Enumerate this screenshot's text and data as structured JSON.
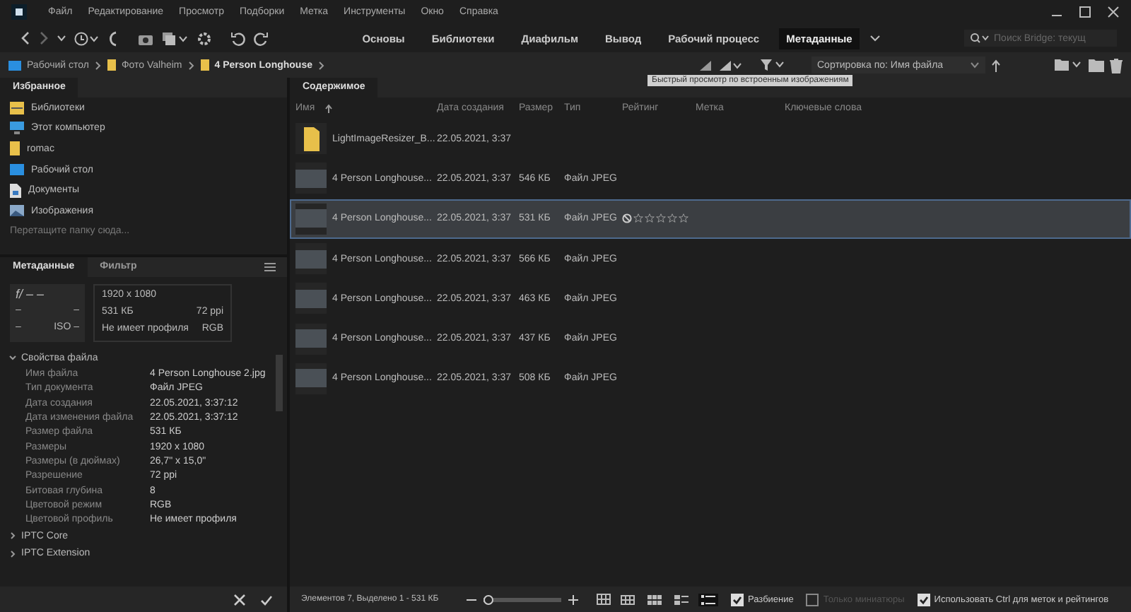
{
  "menu": [
    "Файл",
    "Редактирование",
    "Просмотр",
    "Подборки",
    "Метка",
    "Инструменты",
    "Окно",
    "Справка"
  ],
  "workspaces": [
    {
      "label": "Основы",
      "selected": false
    },
    {
      "label": "Библиотеки",
      "selected": false
    },
    {
      "label": "Диафильм",
      "selected": false
    },
    {
      "label": "Вывод",
      "selected": false
    },
    {
      "label": "Рабочий процесс",
      "selected": false
    },
    {
      "label": "Метаданные",
      "selected": true
    }
  ],
  "search": {
    "placeholder": "Поиск Bridge: текущ"
  },
  "path": [
    {
      "label": "Рабочий стол",
      "kind": "desktop"
    },
    {
      "label": "Фото Valheim",
      "kind": "folder"
    },
    {
      "label": "4 Person Longhouse",
      "kind": "folder"
    }
  ],
  "sort": {
    "value": "Сортировка по: Имя файла"
  },
  "tooltip": "Быстрый просмотр по встроенным изображениям",
  "favorites": {
    "tab": "Избранное",
    "items": [
      {
        "label": "Библиотеки",
        "kind": "library"
      },
      {
        "label": "Этот компьютер",
        "kind": "computer"
      },
      {
        "label": "romac",
        "kind": "user"
      },
      {
        "label": "Рабочий стол",
        "kind": "desktop"
      },
      {
        "label": "Документы",
        "kind": "document"
      },
      {
        "label": "Изображения",
        "kind": "image"
      }
    ],
    "hint": "Перетащите папку сюда..."
  },
  "meta_tabs": [
    {
      "label": "Метаданные",
      "selected": true
    },
    {
      "label": "Фильтр",
      "selected": false
    }
  ],
  "camera": [
    [
      "f/ –  –"
    ],
    [
      "–",
      "–"
    ],
    [
      "–",
      "ISO –"
    ]
  ],
  "image_info": [
    [
      "1920 x 1080"
    ],
    [
      "531 КБ",
      "72 ppi"
    ],
    [
      "Не имеет профиля",
      "RGB"
    ]
  ],
  "file_props": {
    "title": "Свойства файла",
    "expanded": true,
    "rows": [
      [
        "Имя файла",
        "4 Person Longhouse 2.jpg"
      ],
      [
        "Тип документа",
        "Файл JPEG"
      ],
      [
        "Дата создания",
        "22.05.2021, 3:37:12"
      ],
      [
        "Дата изменения файла",
        "22.05.2021, 3:37:12"
      ],
      [
        "Размер файла",
        "531 КБ"
      ],
      [
        "Размеры",
        "1920 x 1080"
      ],
      [
        "Размеры (в дюймах)",
        "26,7\" x 15,0\""
      ],
      [
        "Разрешение",
        "72 ppi"
      ],
      [
        "Битовая глубина",
        "8"
      ],
      [
        "Цветовой режим",
        "RGB"
      ],
      [
        "Цветовой профиль",
        "Не имеет профиля"
      ]
    ]
  },
  "sections": [
    {
      "title": "IPTC Core",
      "expanded": false
    },
    {
      "title": "IPTC Extension",
      "expanded": false
    }
  ],
  "content": {
    "tab": "Содержимое",
    "columns": [
      "Имя",
      "Дата создания",
      "Размер",
      "Тип",
      "Рейтинг",
      "Метка",
      "Ключевые слова"
    ],
    "rows": [
      {
        "kind": "folder",
        "name": "LightImageResizer_B...",
        "date": "22.05.2021, 3:37",
        "selected": false
      },
      {
        "kind": "file",
        "name": "4 Person Longhouse...",
        "date": "22.05.2021, 3:37",
        "size": "546 КБ",
        "type": "Файл JPEG",
        "selected": false
      },
      {
        "kind": "file",
        "name": "4 Person Longhouse...",
        "date": "22.05.2021, 3:37",
        "size": "531 КБ",
        "type": "Файл JPEG",
        "selected": true,
        "stars": 0
      },
      {
        "kind": "file",
        "name": "4 Person Longhouse...",
        "date": "22.05.2021, 3:37",
        "size": "566 КБ",
        "type": "Файл JPEG",
        "selected": false
      },
      {
        "kind": "file",
        "name": "4 Person Longhouse...",
        "date": "22.05.2021, 3:37",
        "size": "463 КБ",
        "type": "Файл JPEG",
        "selected": false
      },
      {
        "kind": "file",
        "name": "4 Person Longhouse...",
        "date": "22.05.2021, 3:37",
        "size": "437 КБ",
        "type": "Файл JPEG",
        "selected": false
      },
      {
        "kind": "file",
        "name": "4 Person Longhouse...",
        "date": "22.05.2021, 3:37",
        "size": "508 КБ",
        "type": "Файл JPEG",
        "selected": false
      }
    ]
  },
  "status": {
    "text": "Элементов 7, Выделено 1 - 531 КБ",
    "zoom": {
      "level": 0.05
    },
    "views": [
      {
        "kind": "grid",
        "selected": false
      },
      {
        "kind": "thumbs",
        "selected": false
      },
      {
        "kind": "details",
        "selected": false
      },
      {
        "kind": "list",
        "selected": true
      }
    ],
    "options": [
      {
        "label": "Разбиение",
        "checked": true,
        "disabled": false
      },
      {
        "label": "Только миниатюры",
        "checked": false,
        "disabled": true
      },
      {
        "label": "Использовать Ctrl для меток и рейтингов",
        "checked": true,
        "disabled": false
      }
    ]
  }
}
